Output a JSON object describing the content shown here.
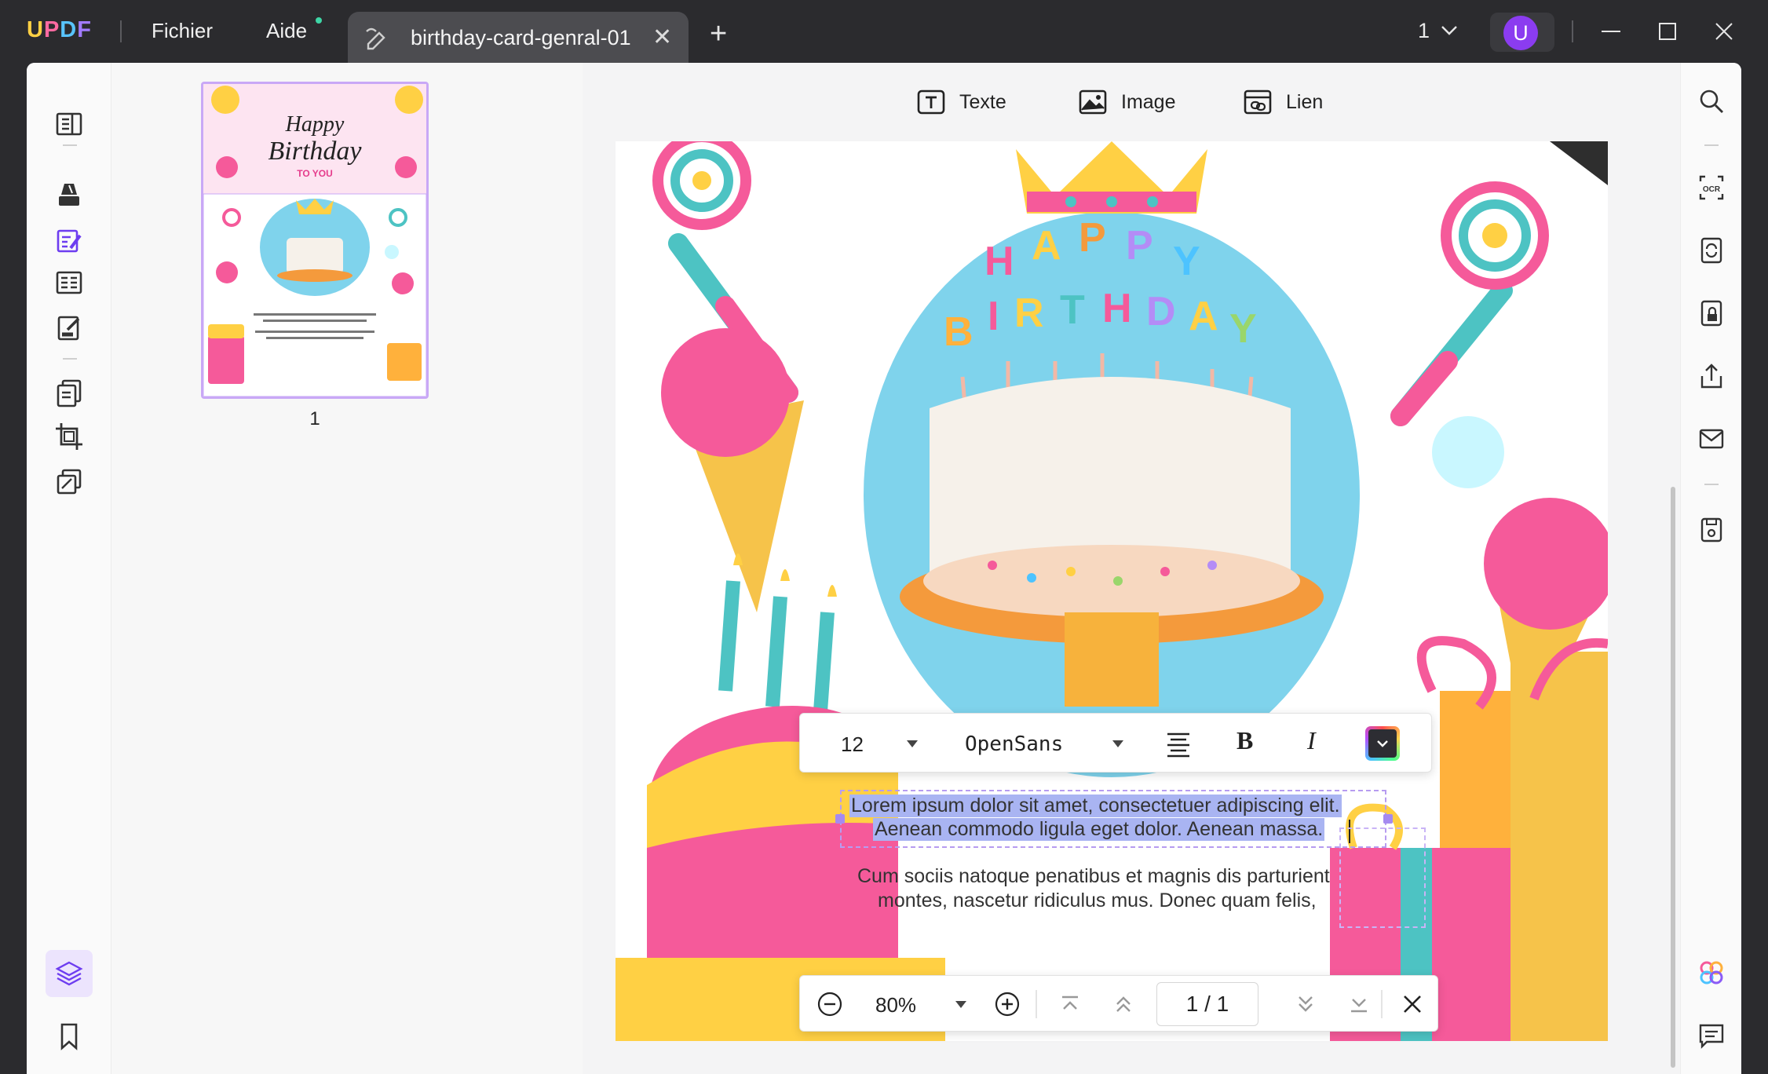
{
  "app": {
    "logo": "UPDF",
    "menu": [
      "Fichier",
      "Aide"
    ]
  },
  "tab": {
    "title": "birthday-card-genral-01"
  },
  "titlebar": {
    "page_selector": "1",
    "user_initial": "U"
  },
  "toolbar": {
    "text_label": "Texte",
    "image_label": "Image",
    "link_label": "Lien"
  },
  "thumbnails": {
    "page_number": "1"
  },
  "card": {
    "heading_line1": "Happy",
    "heading_line2": "Birthday",
    "heading_line3": "TO YOU",
    "candle_letters": "HAPPY BIRTHDAY"
  },
  "font_toolbar": {
    "size": "12",
    "font": "OpenSans",
    "bold_label": "B",
    "italic_label": "I"
  },
  "document_text": {
    "selected_line1": "Lorem ipsum dolor sit amet, consectetuer adipiscing elit.",
    "selected_line2": "Aenean commodo ligula eget dolor. Aenean massa.",
    "body_line1": "Cum sociis natoque penatibus et magnis dis parturient",
    "body_line2": "montes, nascetur ridiculus mus. Donec quam felis,"
  },
  "navigation": {
    "zoom": "80%",
    "page_indicator": "1 / 1"
  },
  "colors": {
    "accent": "#8b5cf6",
    "selection": "#a9b4f2",
    "titlebar": "#2b2b2e",
    "cake_bg": "#7fd3ec"
  }
}
